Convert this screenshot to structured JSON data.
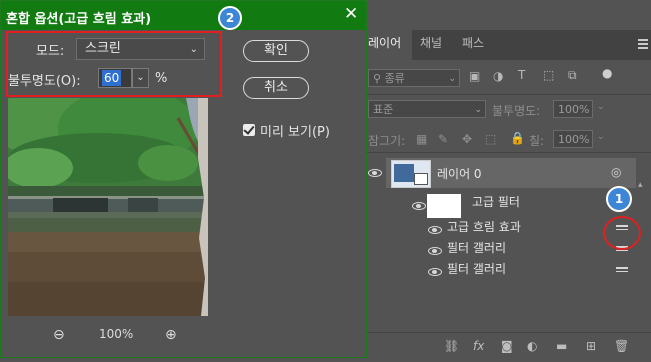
{
  "dialog": {
    "title": "혼합 옵션(고급 흐림 효과)",
    "close_glyph": "✕",
    "mode_label": "모드:",
    "mode_value": "스크린",
    "opacity_label": "불투명도(O):",
    "opacity_value": "60",
    "opacity_unit": "%",
    "ok_label": "확인",
    "cancel_label": "취소",
    "preview_label": "미리 보기(P)",
    "preview_checked": true,
    "zoom_level": "100%",
    "zoom_out_glyph": "⊖",
    "zoom_in_glyph": "⊕"
  },
  "callouts": {
    "badge1": "1",
    "badge2": "2",
    "color": "#e02020",
    "badge_color": "#3d86d6"
  },
  "layers_panel": {
    "tabs": [
      "레이어",
      "채널",
      "패스"
    ],
    "kind_filter": "종류",
    "blend_mode": "표준",
    "opacity_label": "불투명도:",
    "opacity_value": "100%",
    "lock_label": "잠그기:",
    "fill_label": "칠:",
    "fill_value": "100%",
    "layers": [
      {
        "name": "레이어 0"
      },
      {
        "name": "고급 필터"
      },
      {
        "name": "고급 흐림 효과"
      },
      {
        "name": "필터 갤러리"
      },
      {
        "name": "필터 갤러리"
      }
    ]
  },
  "colors": {
    "title_bar": "#117a11",
    "panel_bg": "#535353",
    "highlight": "#2f6fd0"
  }
}
